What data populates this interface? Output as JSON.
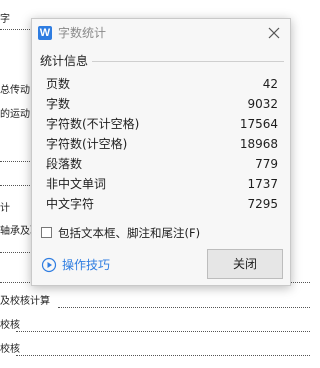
{
  "background_document": {
    "lines": [
      "字",
      "总传动",
      "的运动",
      "计",
      "轴承及联",
      "及校核计算",
      "校核",
      "校核"
    ]
  },
  "dialog": {
    "app_icon_glyph": "W",
    "title": "字数统计",
    "group_title": "统计信息",
    "stats": [
      {
        "label": "页数",
        "value": "42"
      },
      {
        "label": "字数",
        "value": "9032"
      },
      {
        "label": "字符数(不计空格)",
        "value": "17564"
      },
      {
        "label": "字符数(计空格)",
        "value": "18968"
      },
      {
        "label": "段落数",
        "value": "779"
      },
      {
        "label": "非中文单词",
        "value": "1737"
      },
      {
        "label": "中文字符",
        "value": "7295"
      }
    ],
    "include_checkbox": {
      "label": "包括文本框、脚注和尾注(F)",
      "checked": false
    },
    "tips_link": "操作技巧",
    "close_button": "关闭"
  },
  "colors": {
    "accent": "#2f7de1",
    "title_text": "#8a8a8a"
  },
  "icons": {
    "app": "wps-writer-icon",
    "close": "close-icon",
    "tips": "play-circle-icon"
  }
}
